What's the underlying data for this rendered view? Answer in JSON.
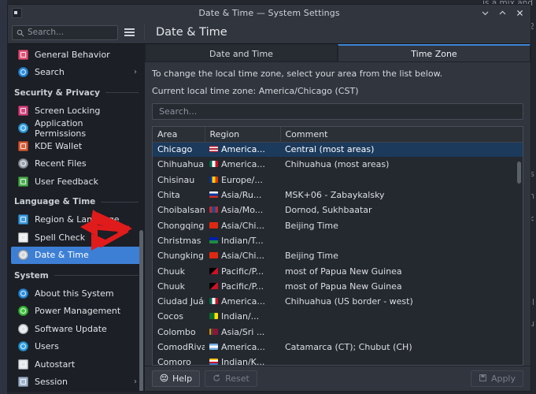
{
  "desktop": {
    "bg_text_top": "is a mix and",
    "bg_fragments": [
      "2",
      "s",
      "h",
      "<",
      "gl",
      "hu"
    ]
  },
  "window": {
    "title": "Date & Time — System Settings",
    "controls": [
      {
        "name": "minimize",
        "glyph": "chevron-down"
      },
      {
        "name": "maximize",
        "glyph": "chevron-up"
      },
      {
        "name": "close",
        "glyph": "x"
      }
    ]
  },
  "header": {
    "search_placeholder": "Search...",
    "search_value": "",
    "menu_label": "hamburger-menu",
    "page_title": "Date & Time"
  },
  "sidebar": {
    "items": [
      {
        "type": "item",
        "label": "General Behavior",
        "icon": "general-behavior-icon",
        "selected": false,
        "chevron": false,
        "color": "#e4537a"
      },
      {
        "type": "item",
        "label": "Search",
        "icon": "search-icon",
        "selected": false,
        "chevron": true,
        "color": "#2d8fe0"
      },
      {
        "type": "group",
        "label": "Security & Privacy"
      },
      {
        "type": "item",
        "label": "Screen Locking",
        "icon": "screen-locking-icon",
        "selected": false,
        "chevron": false,
        "color": "#d6457f"
      },
      {
        "type": "item",
        "label": "Application Permissions",
        "icon": "application-permissions-icon",
        "selected": false,
        "chevron": false,
        "color": "#3aa5e8"
      },
      {
        "type": "item",
        "label": "KDE Wallet",
        "icon": "kde-wallet-icon",
        "selected": false,
        "chevron": false,
        "color": "#d9603a"
      },
      {
        "type": "item",
        "label": "Recent Files",
        "icon": "recent-files-icon",
        "selected": false,
        "chevron": false,
        "color": "#9aa3ae"
      },
      {
        "type": "item",
        "label": "User Feedback",
        "icon": "user-feedback-icon",
        "selected": false,
        "chevron": false,
        "color": "#4caf50"
      },
      {
        "type": "group",
        "label": "Language & Time"
      },
      {
        "type": "item",
        "label": "Region & Language",
        "icon": "region-language-icon",
        "selected": false,
        "chevron": false,
        "color": "#3d9ce0"
      },
      {
        "type": "item",
        "label": "Spell Check",
        "icon": "spell-check-icon",
        "selected": false,
        "chevron": false,
        "color": "#e8eaec"
      },
      {
        "type": "item",
        "label": "Date & Time",
        "icon": "date-time-icon",
        "selected": true,
        "chevron": false,
        "color": "#cfd4da"
      },
      {
        "type": "group",
        "label": "System"
      },
      {
        "type": "item",
        "label": "About this System",
        "icon": "about-system-icon",
        "selected": false,
        "chevron": false,
        "color": "#2d8fe0"
      },
      {
        "type": "item",
        "label": "Power Management",
        "icon": "power-management-icon",
        "selected": false,
        "chevron": false,
        "color": "#3fc23f"
      },
      {
        "type": "item",
        "label": "Software Update",
        "icon": "software-update-icon",
        "selected": false,
        "chevron": false,
        "color": "#dfe3e8"
      },
      {
        "type": "item",
        "label": "Users",
        "icon": "users-icon",
        "selected": false,
        "chevron": false,
        "color": "#2d9fe0"
      },
      {
        "type": "item",
        "label": "Autostart",
        "icon": "autostart-icon",
        "selected": false,
        "chevron": false,
        "color": "#dfe3e8"
      },
      {
        "type": "item",
        "label": "Session",
        "icon": "session-icon",
        "selected": false,
        "chevron": true,
        "color": "#9fb4cc"
      }
    ]
  },
  "main": {
    "tabs": [
      {
        "label": "Date and Time",
        "active": false
      },
      {
        "label": "Time Zone",
        "active": true
      }
    ],
    "instruction": "To change the local time zone, select your area from the list below.",
    "current_zone": "Current local time zone: America/Chicago (CST)",
    "search_placeholder": "Search...",
    "search_value": "",
    "table": {
      "columns": [
        "Area",
        "Region",
        "Comment"
      ],
      "rows": [
        {
          "area": "Chicago",
          "region": "America...",
          "comment": "Central (most areas)",
          "flag": "us",
          "selected": true
        },
        {
          "area": "Chihuahua",
          "region": "America...",
          "comment": "Chihuahua (most areas)",
          "flag": "mx",
          "selected": false
        },
        {
          "area": "Chisinau",
          "region": "Europe/...",
          "comment": "",
          "flag": "md",
          "selected": false
        },
        {
          "area": "Chita",
          "region": "Asia/Ru...",
          "comment": "MSK+06 - Zabaykalsky",
          "flag": "ru",
          "selected": false
        },
        {
          "area": "Choibalsan",
          "region": "Asia/Mo...",
          "comment": "Dornod, Sukhbaatar",
          "flag": "mn",
          "selected": false
        },
        {
          "area": "Chongqing",
          "region": "Asia/Chi...",
          "comment": "Beijing Time",
          "flag": "cn",
          "selected": false
        },
        {
          "area": "Christmas",
          "region": "Indian/T...",
          "comment": "",
          "flag": "cx",
          "selected": false
        },
        {
          "area": "Chungking",
          "region": "Asia/Chi...",
          "comment": "Beijing Time",
          "flag": "cn",
          "selected": false
        },
        {
          "area": "Chuuk",
          "region": "Pacific/P...",
          "comment": "most of Papua New Guinea",
          "flag": "pg",
          "selected": false
        },
        {
          "area": "Chuuk",
          "region": "Pacific/P...",
          "comment": "most of Papua New Guinea",
          "flag": "pg",
          "selected": false
        },
        {
          "area": "Ciudad Juár...",
          "region": "America...",
          "comment": "Chihuahua (US border - west)",
          "flag": "mx",
          "selected": false
        },
        {
          "area": "Cocos",
          "region": "Indian/...",
          "comment": "",
          "flag": "cc",
          "selected": false
        },
        {
          "area": "Colombo",
          "region": "Asia/Sri ...",
          "comment": "",
          "flag": "lk",
          "selected": false
        },
        {
          "area": "ComodRiva...",
          "region": "America...",
          "comment": "Catamarca (CT); Chubut (CH)",
          "flag": "ar",
          "selected": false
        },
        {
          "area": "Comoro",
          "region": "Indian/K...",
          "comment": "",
          "flag": "km",
          "selected": false
        }
      ]
    }
  },
  "footer": {
    "help_label": "Help",
    "reset_label": "Reset",
    "apply_label": "Apply"
  },
  "annotation": {
    "type": "red-arrow",
    "color": "#e01b1b"
  }
}
